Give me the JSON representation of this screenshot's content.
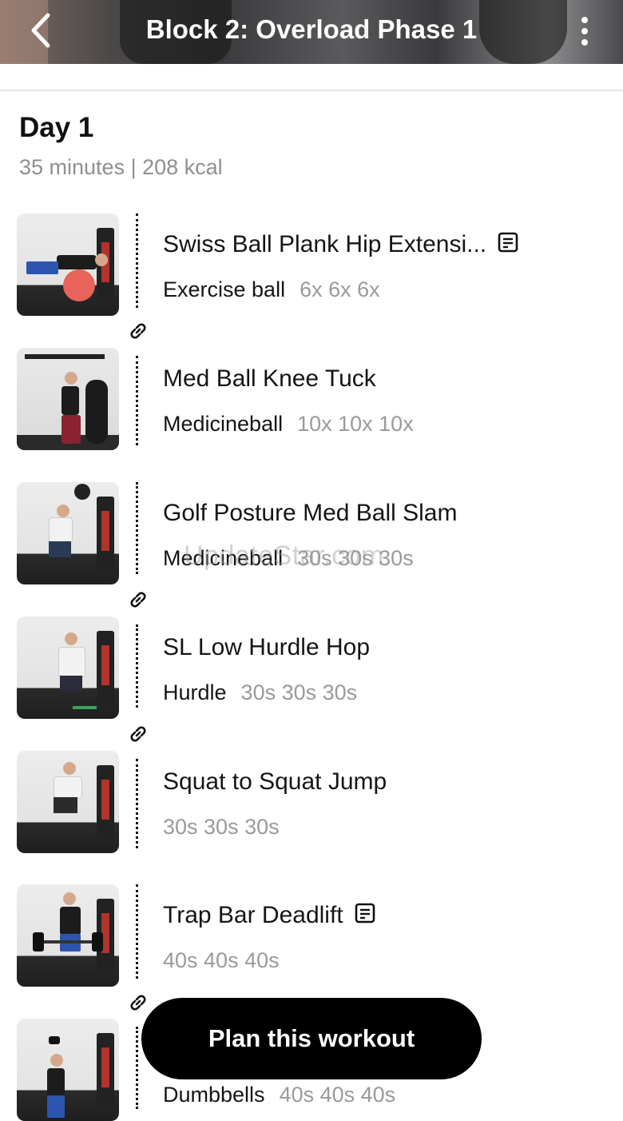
{
  "header": {
    "title": "Block 2: Overload Phase 1"
  },
  "day": {
    "title": "Day 1",
    "meta": "35 minutes | 208 kcal"
  },
  "exercises": [
    {
      "name": "Swiss Ball Plank Hip Extensi...",
      "equipment": "Exercise ball",
      "sets": "6x 6x 6x",
      "has_note": true
    },
    {
      "name": "Med Ball Knee Tuck",
      "equipment": "Medicineball",
      "sets": "10x 10x 10x",
      "has_note": false
    },
    {
      "name": "Golf Posture Med Ball Slam",
      "equipment": "Medicineball",
      "sets": "30s 30s 30s",
      "has_note": false
    },
    {
      "name": "SL Low Hurdle Hop",
      "equipment": "Hurdle",
      "sets": "30s 30s 30s",
      "has_note": false
    },
    {
      "name": "Squat to Squat Jump",
      "equipment": "",
      "sets": "30s 30s 30s",
      "has_note": false
    },
    {
      "name": "Trap Bar Deadlift",
      "equipment": "",
      "sets": "40s 40s 40s",
      "has_note": true
    },
    {
      "name": "",
      "equipment": "Dumbbells",
      "sets": "40s 40s 40s",
      "has_note": false
    }
  ],
  "watermark": "UpdateStar.com",
  "cta": {
    "label": "Plan this workout"
  },
  "icons": {
    "back": "chevron-left-icon",
    "more": "more-vertical-icon",
    "note": "note-icon",
    "link": "link-icon"
  }
}
